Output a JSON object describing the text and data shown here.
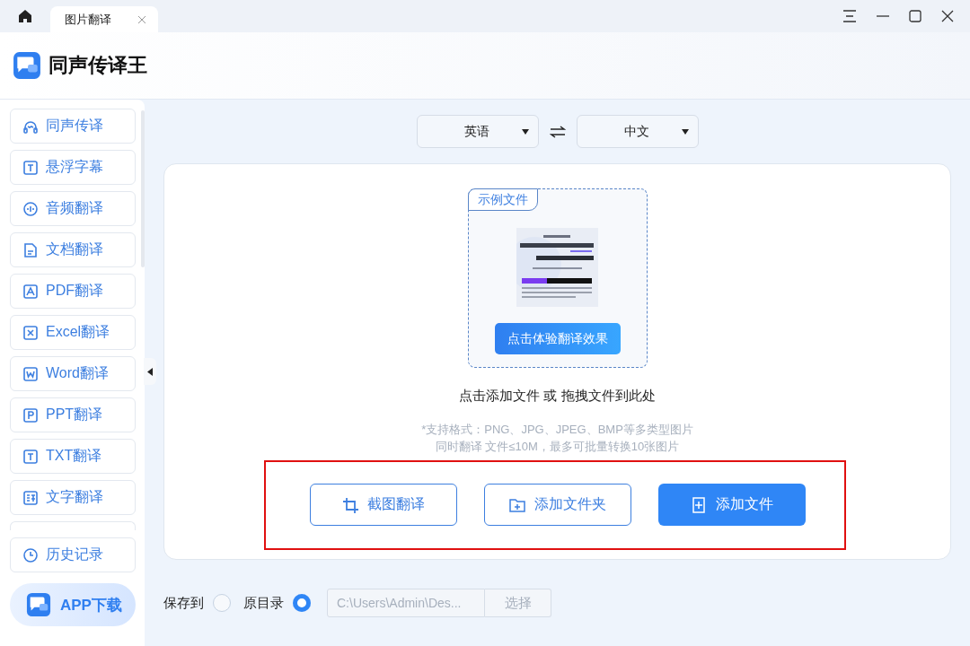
{
  "tabs": [
    {
      "label": "图片翻译",
      "selected": true
    }
  ],
  "app": {
    "name": "同声传译王"
  },
  "sidebar": {
    "items": [
      {
        "label": "同声传译"
      },
      {
        "label": "悬浮字幕"
      },
      {
        "label": "音频翻译"
      },
      {
        "label": "文档翻译"
      },
      {
        "label": "PDF翻译"
      },
      {
        "label": "Excel翻译"
      },
      {
        "label": "Word翻译"
      },
      {
        "label": "PPT翻译"
      },
      {
        "label": "TXT翻译"
      },
      {
        "label": "文字翻译"
      }
    ],
    "history": "历史记录",
    "download": "APP下载"
  },
  "languages": {
    "source": "英语",
    "target": "中文"
  },
  "sample": {
    "badge": "示例文件",
    "button": "点击体验翻译效果"
  },
  "drop_hint": "点击添加文件 或 拖拽文件到此处",
  "formats": [
    "*支持格式：PNG、JPG、JPEG、BMP等多类型图片",
    "同时翻译 文件≤10M，最多可批量转换10张图片"
  ],
  "actions": [
    {
      "label": "截图翻译",
      "primary": false
    },
    {
      "label": "添加文件夹",
      "primary": false
    },
    {
      "label": "添加文件",
      "primary": true
    }
  ],
  "save": {
    "options": [
      {
        "label": "保存到",
        "selected": false
      },
      {
        "label": "原目录",
        "selected": true
      }
    ],
    "path": "C:\\Users\\Admin\\Des...",
    "choose": "选择"
  }
}
